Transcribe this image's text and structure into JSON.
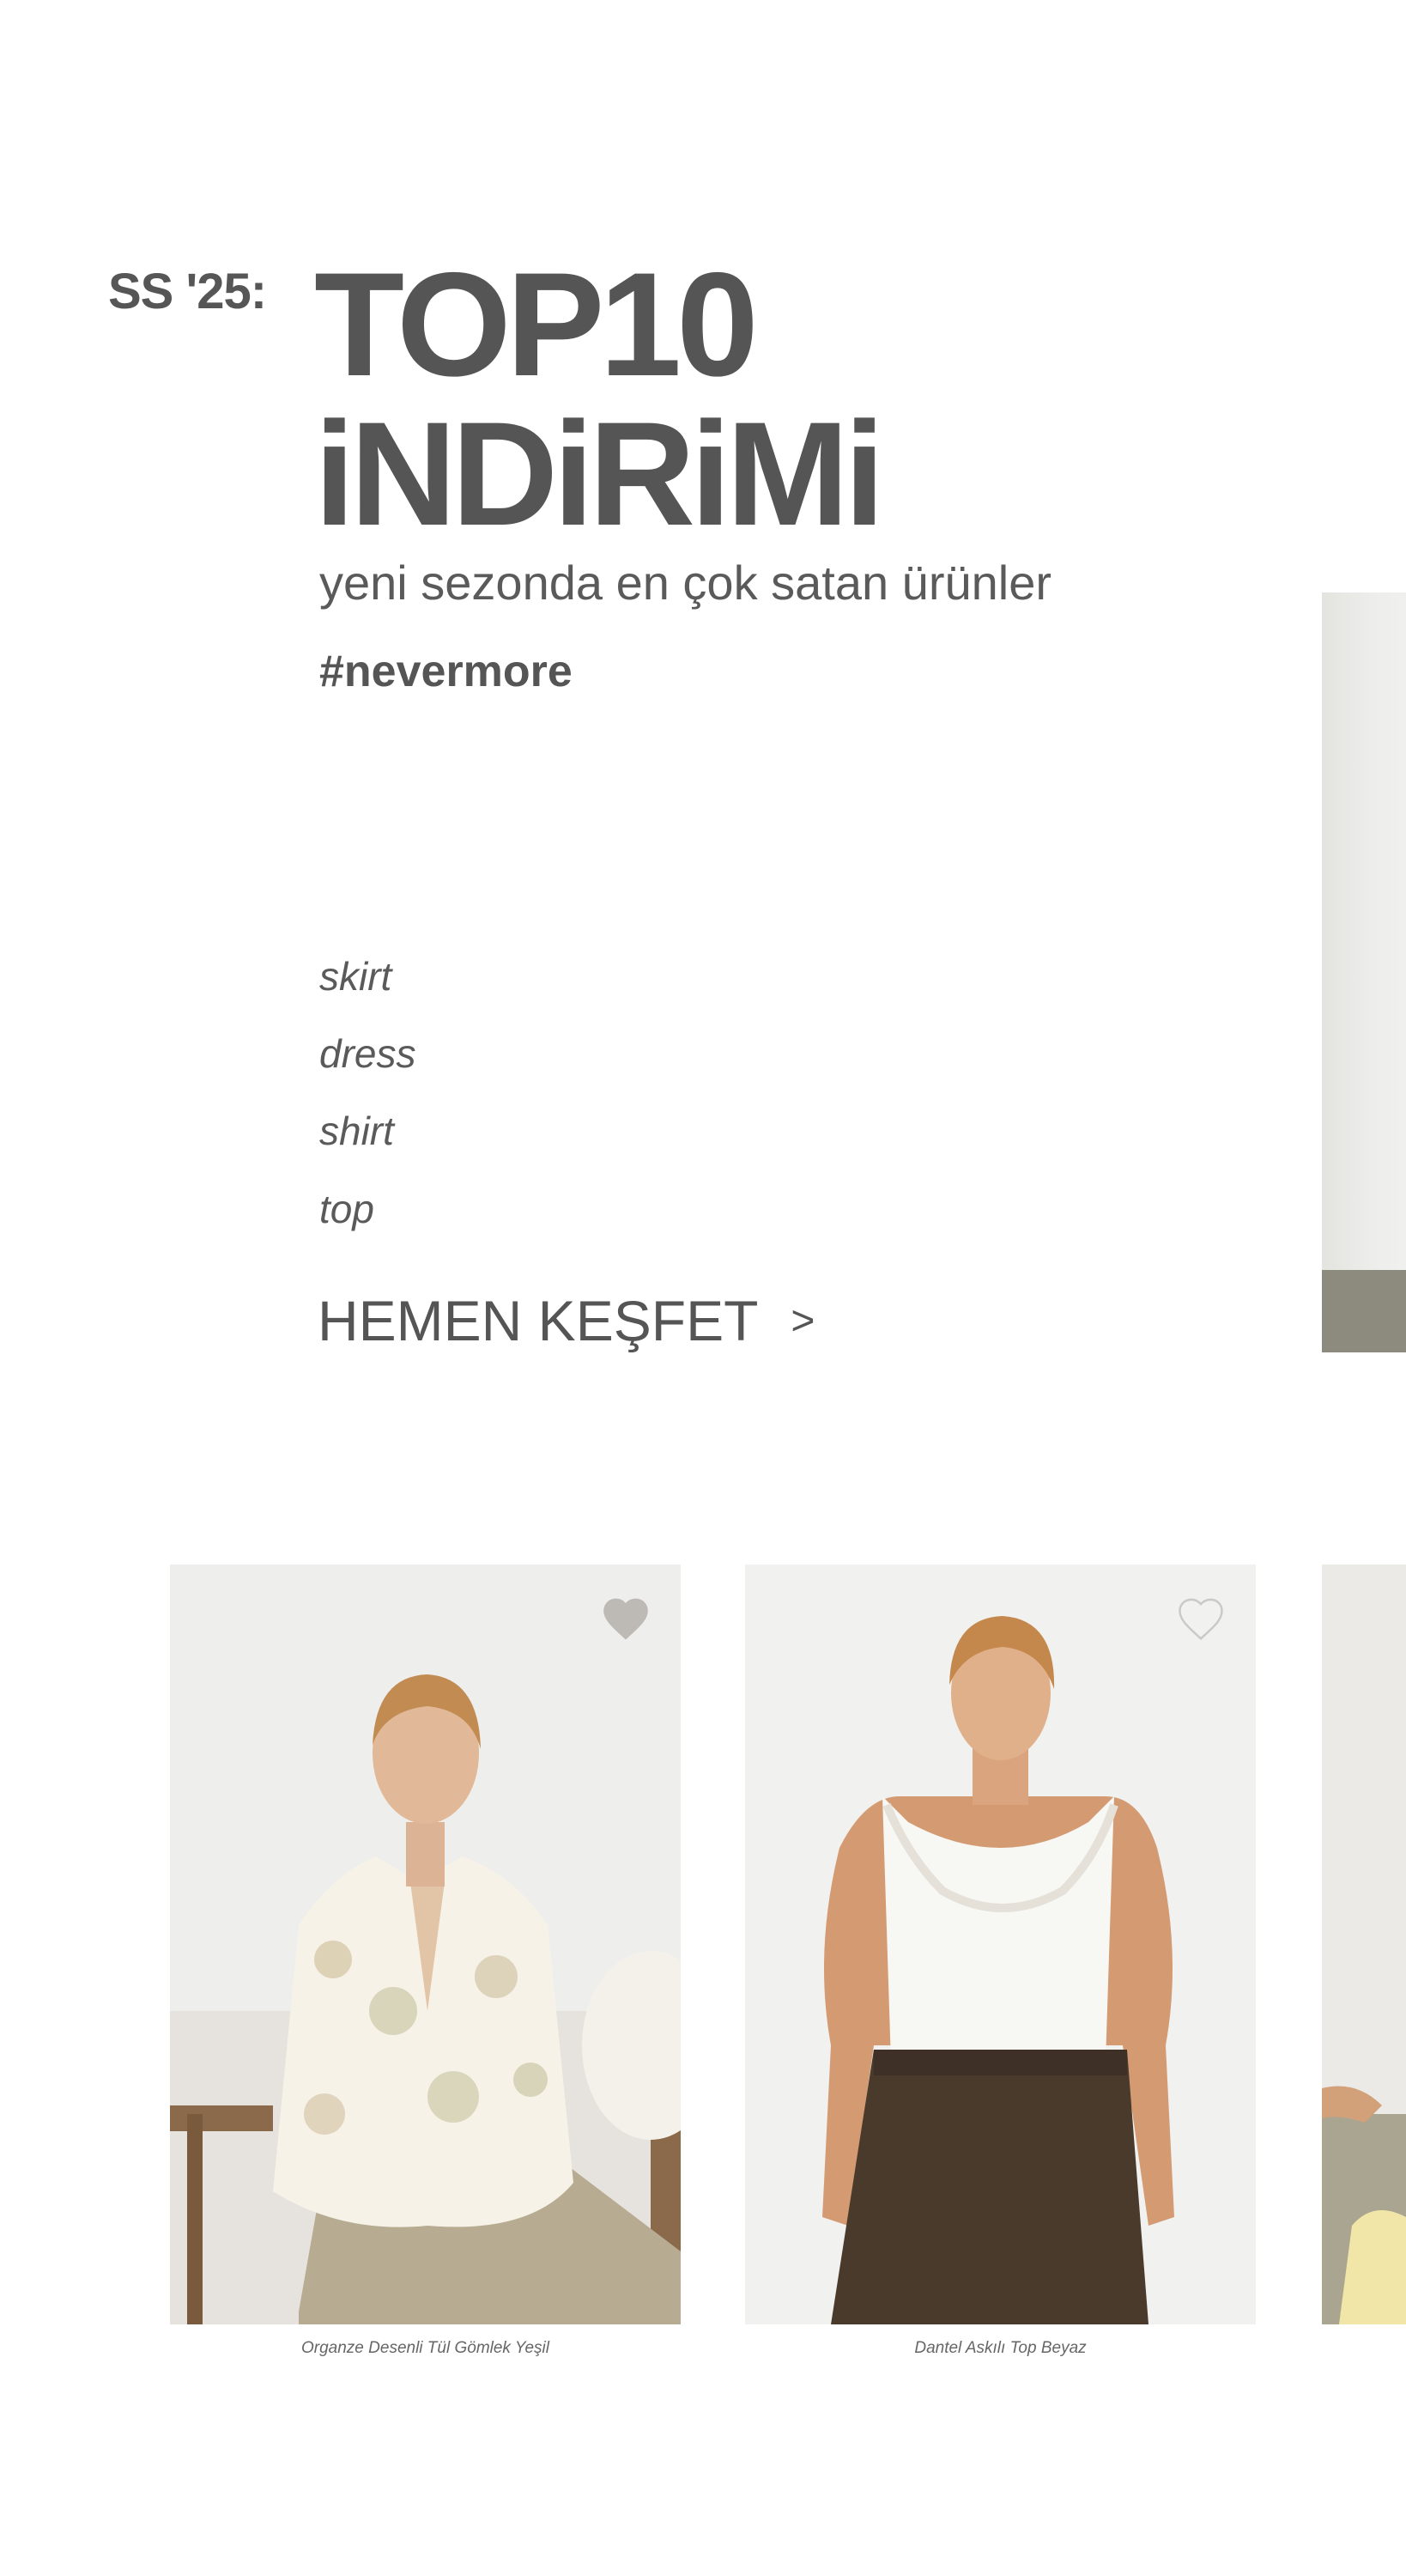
{
  "hero": {
    "season": "SS '25:",
    "title_line1": "TOP10",
    "title_line2": "iNDiRiMi",
    "subtitle": "yeni sezonda en çok satan ürünler",
    "hashtag": "#nevermore",
    "categories": [
      "skirt",
      "dress",
      "shirt",
      "top"
    ],
    "cta_label": "HEMEN KEŞFET",
    "cta_icon": ">"
  },
  "products": [
    {
      "name": "Organze Desenli Tül Gömlek Yeşil",
      "favorited": true,
      "icon": "heart-filled-icon"
    },
    {
      "name": "Dantel Askılı Top Beyaz",
      "favorited": false,
      "icon": "heart-outline-icon"
    }
  ],
  "colors": {
    "text": "#555555",
    "heart_filled": "#bdbab6",
    "heart_outline": "#c9c9c9"
  }
}
